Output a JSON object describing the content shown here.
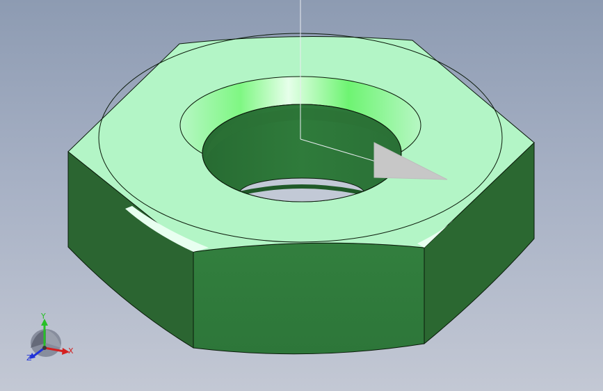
{
  "viewport": {
    "background_top": "#8d9bb2",
    "background_bottom": "#c3c8d4"
  },
  "model": {
    "part": "hex nut",
    "top_face_color": "#b3f5c6",
    "side_face_color": "#2e7b3c",
    "side_face_dark_color": "#2b6a33",
    "bore_color": "#2e7a3a",
    "chamfer_color": "#78f57c",
    "edge_color": "#0a1a0a"
  },
  "triad": {
    "x_label": "X",
    "y_label": "Y",
    "z_label": "Z",
    "x_color": "#d42020",
    "y_color": "#28c028",
    "z_color": "#2032d8"
  }
}
